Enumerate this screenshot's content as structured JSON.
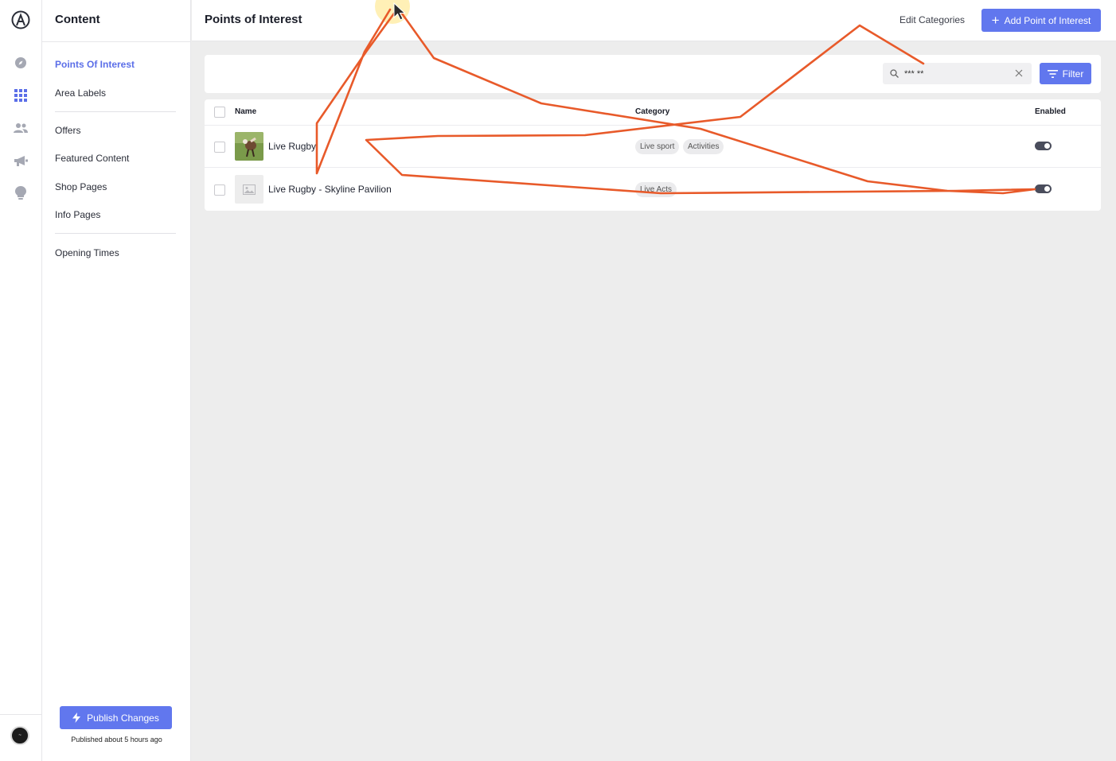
{
  "panel": {
    "title": "Content",
    "nav": [
      {
        "label": "Points Of Interest",
        "active": true
      },
      {
        "label": "Area Labels"
      },
      {
        "label": "Offers"
      },
      {
        "label": "Featured Content"
      },
      {
        "label": "Shop Pages"
      },
      {
        "label": "Info Pages"
      },
      {
        "label": "Opening Times"
      }
    ],
    "publish_label": "Publish Changes",
    "published_status": "Published about 5 hours ago"
  },
  "rail": {
    "icons": [
      "logo-icon",
      "compass-icon",
      "grid-icon",
      "users-icon",
      "megaphone-icon",
      "lightbulb-icon"
    ],
    "accent": "#5b6ee8"
  },
  "header": {
    "title": "Points of Interest",
    "edit_categories": "Edit Categories",
    "add_label": "Add Point of Interest"
  },
  "toolbar": {
    "search_value": "*** **",
    "filter_label": "Filter"
  },
  "table": {
    "columns": {
      "name": "Name",
      "category": "Category",
      "enabled": "Enabled"
    },
    "rows": [
      {
        "name": "Live Rugby",
        "categories": [
          "Live sport",
          "Activities"
        ],
        "enabled": true,
        "thumb": "photo"
      },
      {
        "name": "Live Rugby - Skyline Pavilion",
        "categories": [
          "Live Acts"
        ],
        "enabled": true,
        "thumb": "placeholder-image-icon"
      }
    ]
  },
  "colors": {
    "primary": "#6177ee",
    "annotation": "#e85a2a"
  }
}
